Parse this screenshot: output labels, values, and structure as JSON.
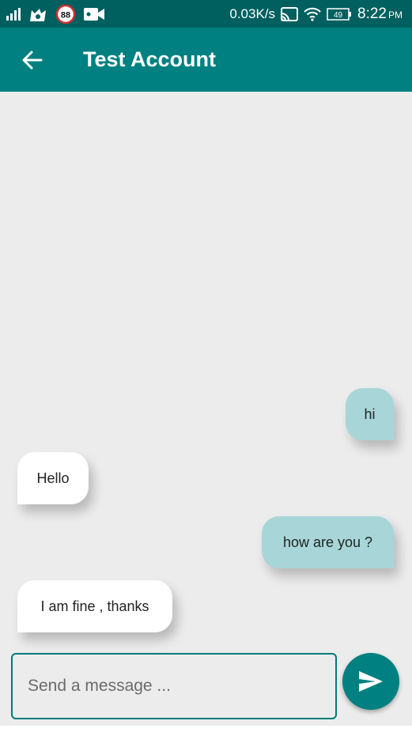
{
  "status_bar": {
    "signal_icon": "signal-bars-icon",
    "app_icons": [
      "cat-app-icon",
      "notification-88-icon",
      "video-camera-icon"
    ],
    "notification_badge": "88",
    "net_speed": "0.03K/s",
    "cast_icon": "cast-icon",
    "wifi_icon": "wifi-icon",
    "battery_level": "49",
    "time": "8:22",
    "ampm": "PM"
  },
  "app_bar": {
    "back_icon": "arrow-left-icon",
    "title": "Test Account"
  },
  "messages": [
    {
      "text": "hi",
      "direction": "outgoing"
    },
    {
      "text": "Hello",
      "direction": "incoming"
    },
    {
      "text": "how are you ?",
      "direction": "outgoing"
    },
    {
      "text": "I am fine , thanks",
      "direction": "incoming"
    }
  ],
  "composer": {
    "placeholder": "Send a message ...",
    "value": "",
    "send_icon": "send-icon"
  },
  "colors": {
    "status_bar": "#005f5f",
    "app_bar": "#008080",
    "background": "#ececec",
    "outgoing_bubble": "#a8d6d8",
    "incoming_bubble": "#ffffff",
    "send_button": "#008080"
  }
}
